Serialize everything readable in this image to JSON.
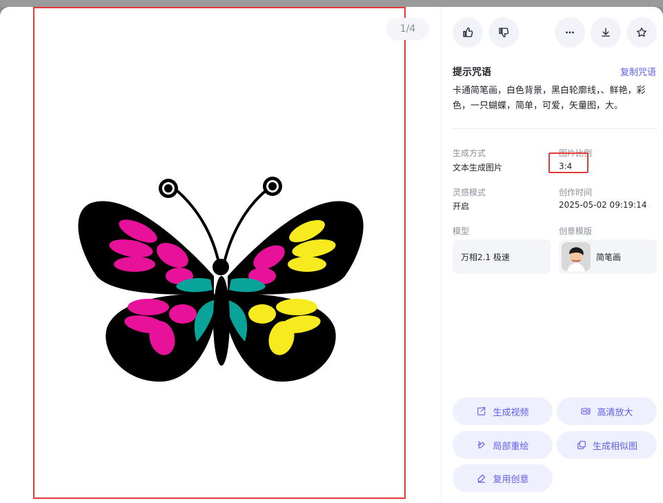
{
  "viewer": {
    "page_counter": "1/4"
  },
  "toolbar": {
    "like_icon": "thumbs-up-icon",
    "dislike_icon": "thumbs-down-icon",
    "more_icon": "more-icon",
    "download_icon": "download-icon",
    "favorite_icon": "star-icon"
  },
  "prompt": {
    "title": "提示咒语",
    "copy_label": "复制咒语",
    "text": "卡通简笔画，白色背景，黑白轮廓线，、鲜艳，彩色，一只蝴蝶，简单，可爱，矢量图，大。"
  },
  "meta": {
    "generation_method_label": "生成方式",
    "generation_method_value": "文本生成图片",
    "aspect_ratio_label": "图片比例",
    "aspect_ratio_value": "3:4",
    "inspiration_mode_label": "灵感模式",
    "inspiration_mode_value": "开启",
    "created_time_label": "创作时间",
    "created_time_value": "2025-05-02 09:19:14",
    "model_label": "模型",
    "model_value": "万相2.1 极速",
    "template_label": "创意模版",
    "template_value": "简笔画"
  },
  "actions": {
    "generate_video": "生成视频",
    "hd_upscale": "高清放大",
    "local_repaint": "局部重绘",
    "generate_similar": "生成相似图",
    "reuse_idea": "复用创意"
  },
  "colors": {
    "accent": "#615ced",
    "highlight_border": "#e53935",
    "butterfly_pink": "#e8129a",
    "butterfly_teal": "#0aa39a",
    "butterfly_yellow": "#f7ea1f"
  }
}
